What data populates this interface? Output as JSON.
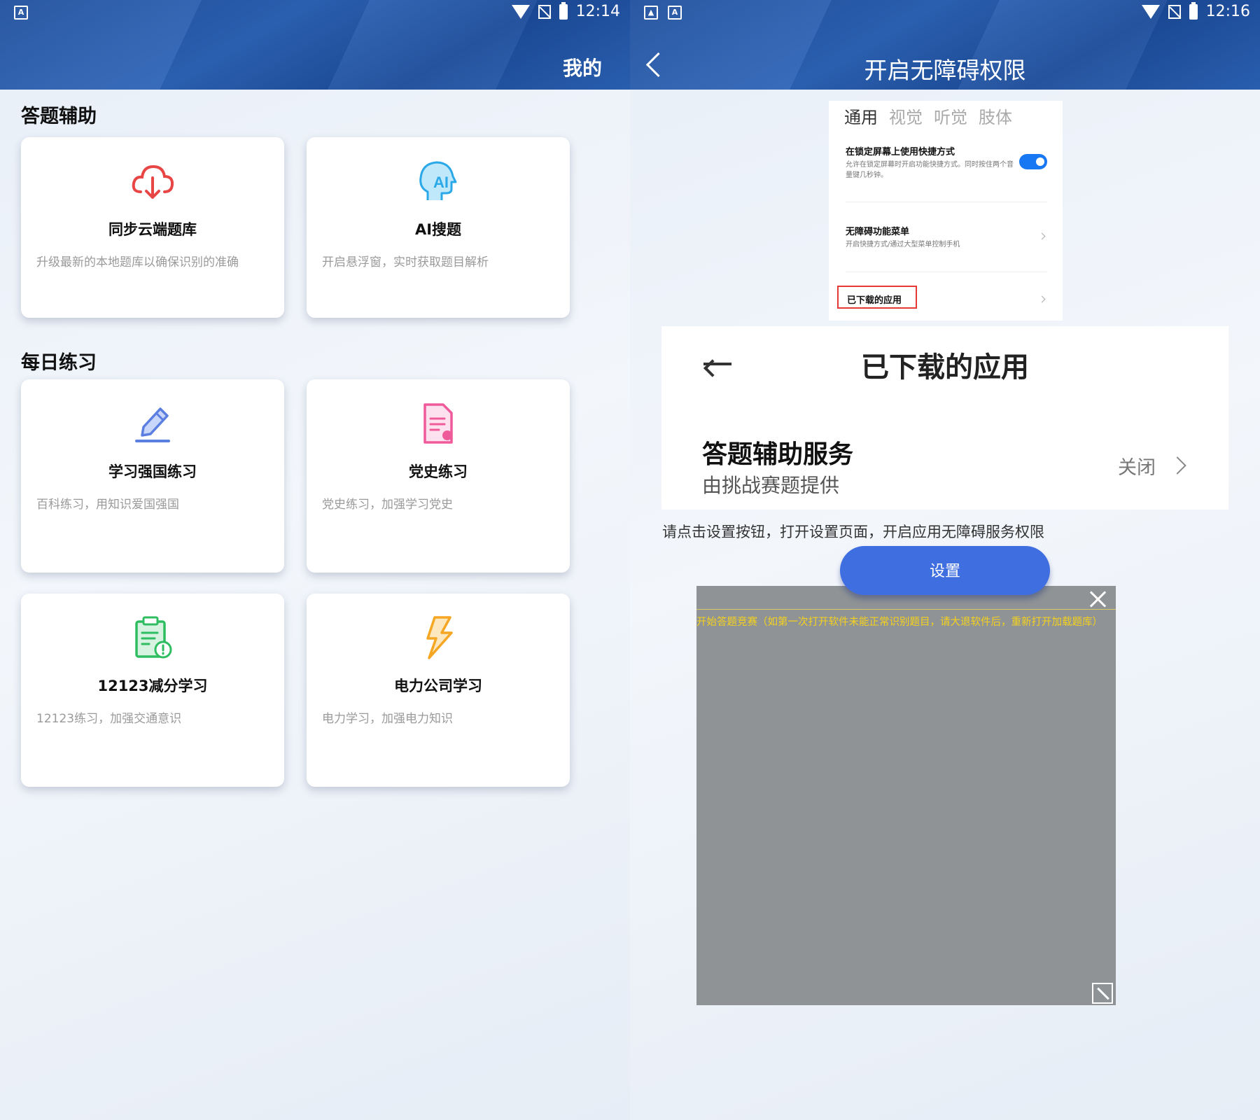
{
  "left": {
    "status": {
      "time": "12:14",
      "notif_icons": [
        "A"
      ]
    },
    "header": {
      "title": "我的"
    },
    "sections": [
      {
        "title": "答题辅助",
        "cards": [
          {
            "title": "同步云端题库",
            "desc": "升级最新的本地题库以确保识别的准确",
            "icon": "cloud-download-icon",
            "color": "#e84545"
          },
          {
            "title": "AI搜题",
            "desc": "开启悬浮窗，实时获取题目解析",
            "icon": "ai-head-icon",
            "color": "#2aa8e8"
          }
        ]
      },
      {
        "title": "每日练习",
        "cards": [
          {
            "title": "学习强国练习",
            "desc": "百科练习，用知识爱国强国",
            "icon": "pen-edit-icon",
            "color": "#5b7fe0"
          },
          {
            "title": "党史练习",
            "desc": "党史练习，加强学习党史",
            "icon": "document-icon",
            "color": "#ef5a9a"
          },
          {
            "title": "12123减分学习",
            "desc": "12123练习，加强交通意识",
            "icon": "clipboard-alert-icon",
            "color": "#2ebd60"
          },
          {
            "title": "电力公司学习",
            "desc": "电力学习，加强电力知识",
            "icon": "lightning-icon",
            "color": "#f5a623"
          }
        ]
      }
    ]
  },
  "right": {
    "status": {
      "time": "12:16",
      "notif_icons": [
        "image",
        "A"
      ]
    },
    "header": {
      "title": "开启无障碍权限"
    },
    "settings_preview": {
      "tabs": [
        "通用",
        "视觉",
        "听觉",
        "肢体"
      ],
      "rows": [
        {
          "title": "在锁定屏幕上使用快捷方式",
          "desc": "允许在锁定屏幕时开启功能快捷方式。同时按住两个音量键几秒钟。"
        },
        {
          "title": "无障碍功能菜单",
          "desc": "开启快捷方式/通过大型菜单控制手机"
        }
      ],
      "downloaded_label": "已下载的应用"
    },
    "app_panel": {
      "title": "已下载的应用",
      "service_name": "答题辅助服务",
      "service_sub": "由挑战赛题提供",
      "status": "关闭"
    },
    "hint": "请点击设置按钮，打开设置页面，开启应用无障碍服务权限",
    "button_label": "设置",
    "overlay_text": "开始答题竞赛（如第一次打开软件未能正常识别题目，请大退软件后，重新打开加载题库）"
  }
}
